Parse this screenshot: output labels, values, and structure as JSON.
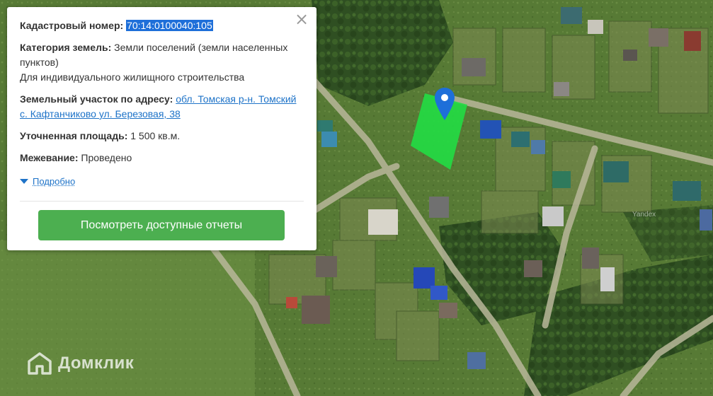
{
  "card": {
    "cadastral_label": "Кадастровый номер:",
    "cadastral_value": "70:14:0100040:105",
    "category_label": "Категория земель:",
    "category_value": "Земли поселений (земли населенных пунктов)",
    "usage_value": "Для индивидуального жилищного строительства",
    "address_label": "Земельный участок по адресу:",
    "address_value": "обл. Томская р-н. Томский с. Кафтанчиково ул. Березовая, 38",
    "area_label": "Уточненная площадь:",
    "area_value": "1 500 кв.м.",
    "survey_label": "Межевание:",
    "survey_value": "Проведено",
    "more_label": "Подробно",
    "report_button": "Посмотреть доступные отчеты",
    "close_symbol": "×"
  },
  "map": {
    "parcel_color": "#22dd44",
    "pin_color": "#1e6fd9",
    "yandex_mark": "Yandex"
  },
  "watermark": {
    "brand": "Домклик"
  },
  "icons": [
    "close-icon",
    "triangle-down-icon",
    "map-pin-icon",
    "domclick-logo-icon"
  ],
  "colors": {
    "button": "#4caf50",
    "link": "#1e73c8",
    "highlight": "#1e6fd9"
  }
}
